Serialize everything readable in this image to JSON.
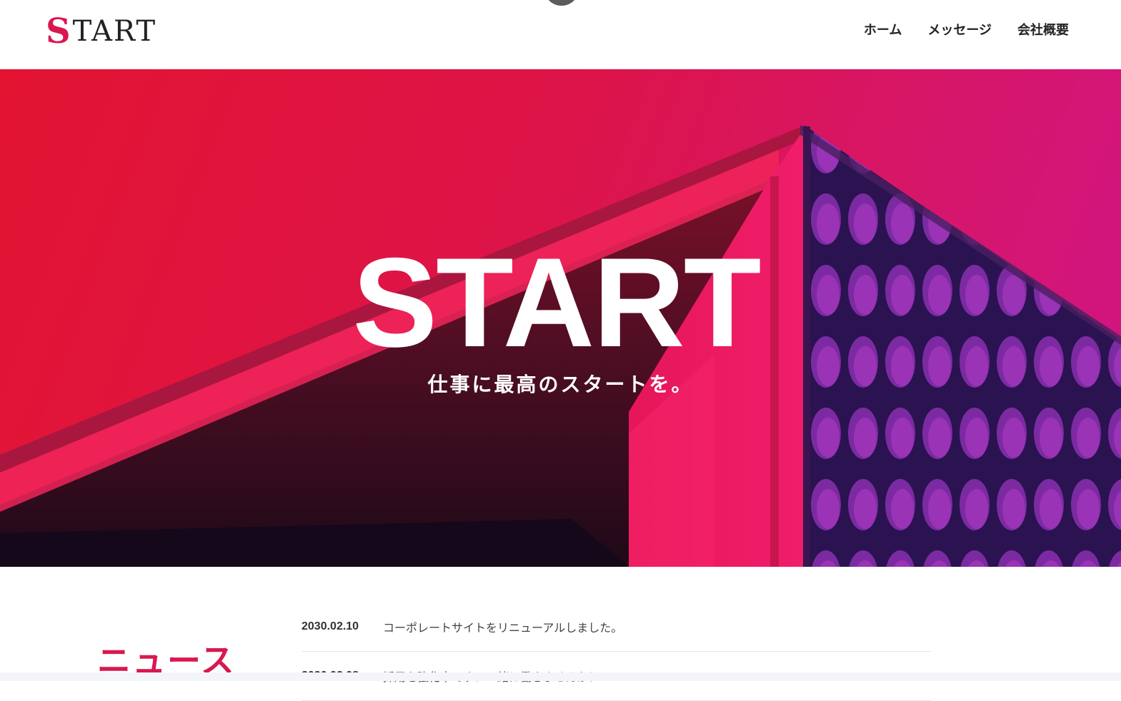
{
  "header": {
    "logo_first": "S",
    "logo_rest": "TART",
    "nav": [
      {
        "label": "ホーム"
      },
      {
        "label": "メッセージ"
      },
      {
        "label": "会社概要"
      }
    ]
  },
  "hero": {
    "title": "START",
    "subtitle": "仕事に最高のスタートを。"
  },
  "news": {
    "heading": "ニュース",
    "items": [
      {
        "date": "2030.02.10",
        "text": "コーポレートサイトをリニューアルしました。"
      },
      {
        "date": "2030.02.08",
        "text": "採用を強化中です！一緒に働きませんか？"
      }
    ]
  },
  "colors": {
    "accent": "#d9184f",
    "hero_gradient_start": "#e31432",
    "hero_gradient_end": "#cf1486"
  }
}
